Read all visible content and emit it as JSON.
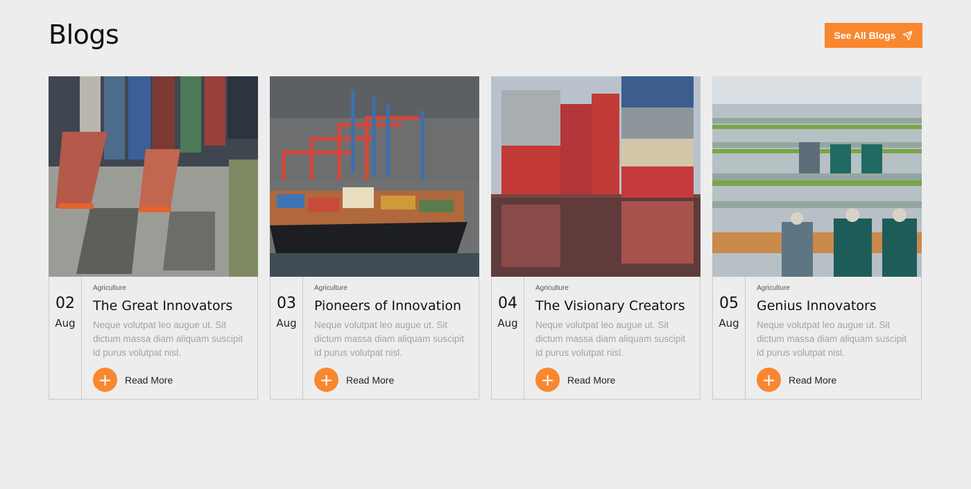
{
  "header": {
    "title": "Blogs",
    "see_all_label": "See All Blogs",
    "see_all_icon": "paper-plane-icon"
  },
  "accent_color": "#f98730",
  "read_more_icon": "plus-icon",
  "cards": [
    {
      "image": "container-yard-aerial-photo",
      "day": "02",
      "month": "Aug",
      "category": "Agriculture",
      "title": "The Great Innovators",
      "excerpt": "Neque volutpat leo augue ut. Sit dictum massa diam aliquam suscipit id purus volutpat nisl.",
      "read_more": "Read More"
    },
    {
      "image": "cargo-ship-cranes-photo",
      "day": "03",
      "month": "Aug",
      "category": "Agriculture",
      "title": "Pioneers of Innovation",
      "excerpt": "Neque volutpat leo augue ut. Sit dictum massa diam aliquam suscipit id purus volutpat nisl.",
      "read_more": "Read More"
    },
    {
      "image": "stacked-containers-reflection-photo",
      "day": "04",
      "month": "Aug",
      "category": "Agriculture",
      "title": "The Visionary Creators",
      "excerpt": "Neque volutpat leo augue ut. Sit dictum massa diam aliquam suscipit id purus volutpat nisl.",
      "read_more": "Read More"
    },
    {
      "image": "food-packing-line-workers-photo",
      "day": "05",
      "month": "Aug",
      "category": "Agriculture",
      "title": "Genius Innovators",
      "excerpt": "Neque volutpat leo augue ut. Sit dictum massa diam aliquam suscipit id purus volutpat nisl.",
      "read_more": "Read More"
    }
  ]
}
